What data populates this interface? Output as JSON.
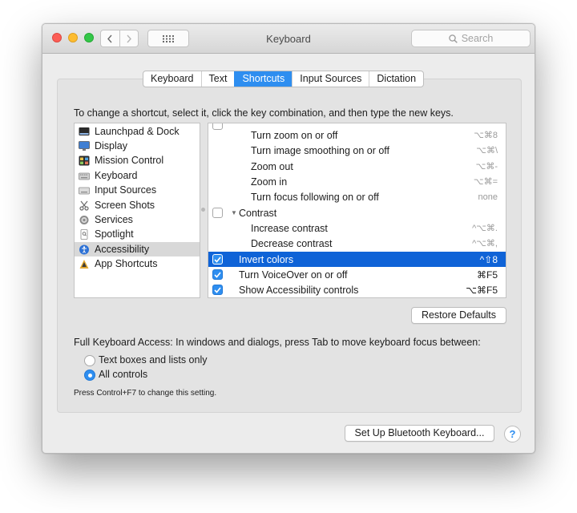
{
  "window": {
    "title": "Keyboard"
  },
  "search": {
    "placeholder": "Search"
  },
  "tabs": [
    "Keyboard",
    "Text",
    "Shortcuts",
    "Input Sources",
    "Dictation"
  ],
  "active_tab": "Shortcuts",
  "instructions": "To change a shortcut, select it, click the key combination, and then type the new keys.",
  "categories": [
    {
      "label": "Launchpad & Dock",
      "icon": "launchpad-dock-icon"
    },
    {
      "label": "Display",
      "icon": "display-icon"
    },
    {
      "label": "Mission Control",
      "icon": "mission-control-icon"
    },
    {
      "label": "Keyboard",
      "icon": "keyboard-icon"
    },
    {
      "label": "Input Sources",
      "icon": "input-sources-icon"
    },
    {
      "label": "Screen Shots",
      "icon": "screen-shots-icon"
    },
    {
      "label": "Services",
      "icon": "services-gear-icon"
    },
    {
      "label": "Spotlight",
      "icon": "spotlight-icon"
    },
    {
      "label": "Accessibility",
      "icon": "accessibility-icon"
    },
    {
      "label": "App Shortcuts",
      "icon": "app-shortcuts-icon"
    }
  ],
  "selected_category": "Accessibility",
  "shortcuts": [
    {
      "label": "Turn zoom on or off",
      "keys": "⌥⌘8"
    },
    {
      "label": "Turn image smoothing on or off",
      "keys": "⌥⌘\\"
    },
    {
      "label": "Zoom out",
      "keys": "⌥⌘-"
    },
    {
      "label": "Zoom in",
      "keys": "⌥⌘="
    },
    {
      "label": "Turn focus following on or off",
      "keys": "none"
    },
    {
      "label": "Contrast",
      "keys": ""
    },
    {
      "label": "Increase contrast",
      "keys": "^⌥⌘."
    },
    {
      "label": "Decrease contrast",
      "keys": "^⌥⌘,"
    },
    {
      "label": "Invert colors",
      "keys": "^⇧8"
    },
    {
      "label": "Turn VoiceOver on or off",
      "keys": "⌘F5"
    },
    {
      "label": "Show Accessibility controls",
      "keys": "⌥⌘F5"
    }
  ],
  "selected_shortcut": "Invert colors",
  "buttons": {
    "restore_defaults": "Restore Defaults",
    "bluetooth": "Set Up Bluetooth Keyboard...",
    "help": "?"
  },
  "full_keyboard_access": {
    "text": "Full Keyboard Access: In windows and dialogs, press Tab to move keyboard focus between:",
    "options": [
      "Text boxes and lists only",
      "All controls"
    ],
    "selected": "All controls",
    "hint": "Press Control+F7 to change this setting."
  },
  "colors": {
    "accent": "#2e8ef0",
    "selection": "#0f63d7"
  }
}
